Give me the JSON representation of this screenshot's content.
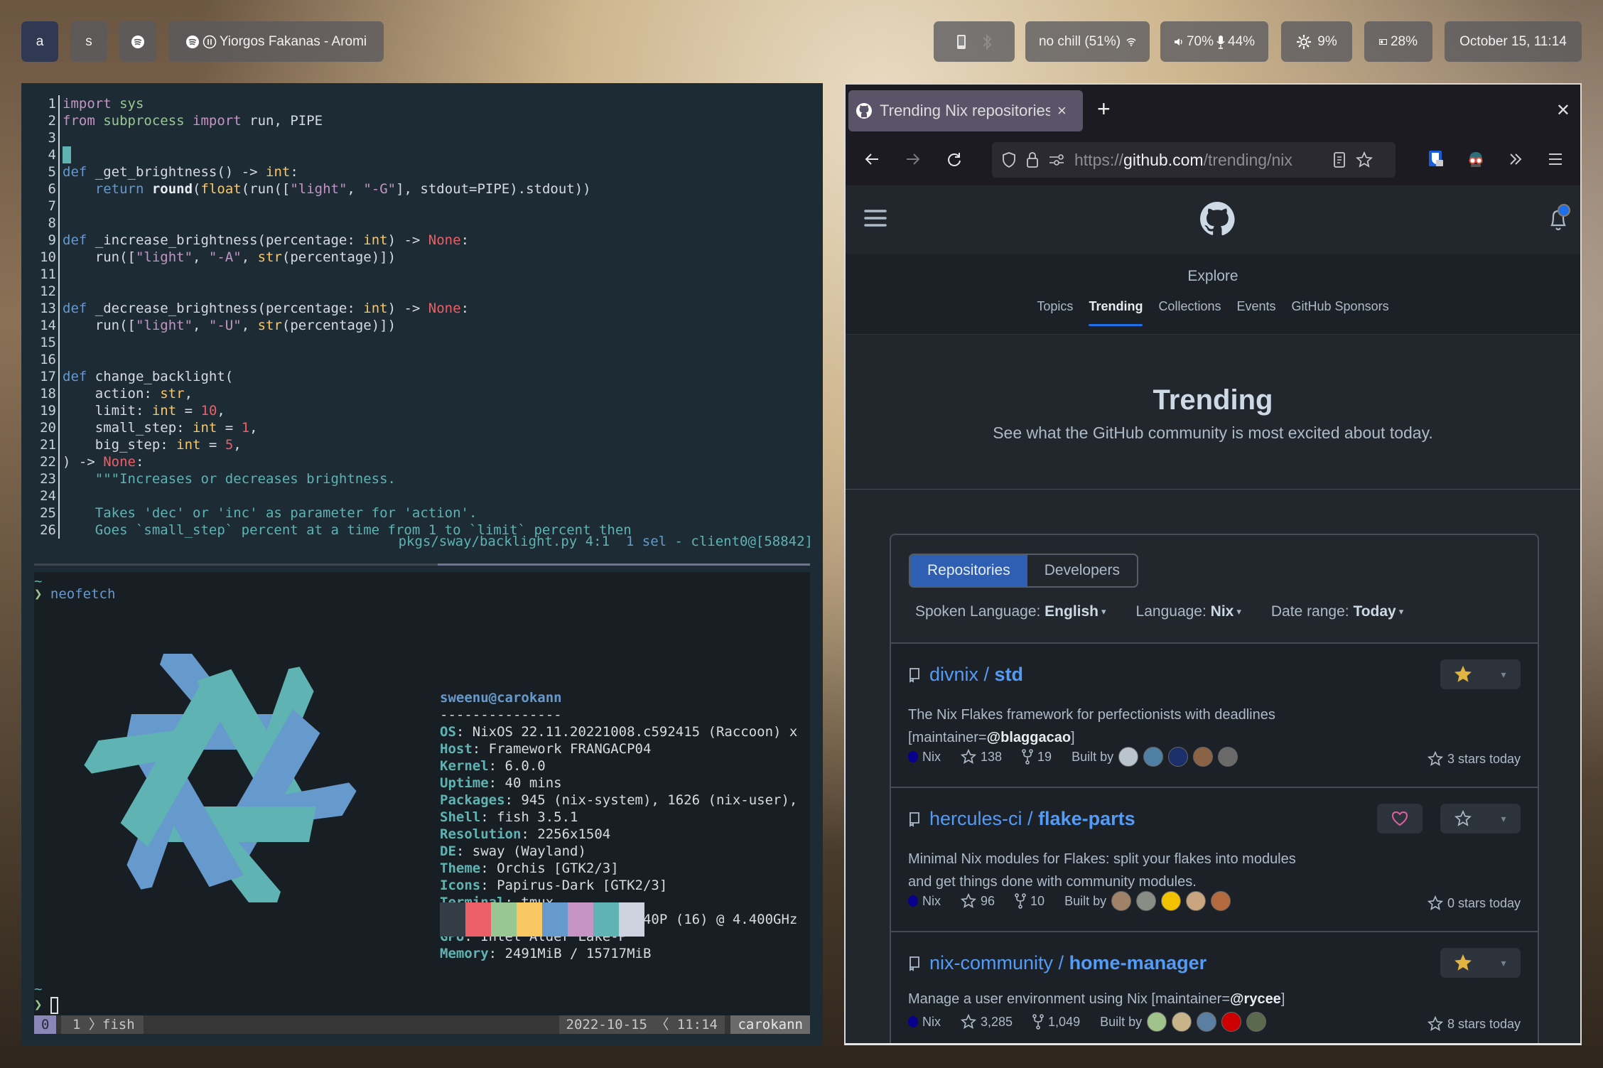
{
  "topbar": {
    "workspaces": [
      {
        "label": "a",
        "active": true
      },
      {
        "label": "s",
        "active": false
      }
    ],
    "spotify_icon": "spotify-icon",
    "media": {
      "track": "Yiorgos Fakanas - Aromi",
      "state_icon": "pause-icon"
    },
    "wifi": "no chill (51%)",
    "audio": {
      "volume": "70%",
      "mic": "44%"
    },
    "cpu": "9%",
    "battery": "28%",
    "clock": "October 15, 11:14"
  },
  "editor": {
    "lines": [
      {
        "n": "1"
      },
      {
        "n": "2"
      },
      {
        "n": "3"
      },
      {
        "n": "4"
      },
      {
        "n": "5"
      },
      {
        "n": "6"
      },
      {
        "n": "7"
      },
      {
        "n": "8"
      },
      {
        "n": "9"
      },
      {
        "n": "10"
      },
      {
        "n": "11"
      },
      {
        "n": "12"
      },
      {
        "n": "13"
      },
      {
        "n": "14"
      },
      {
        "n": "15"
      },
      {
        "n": "16"
      },
      {
        "n": "17"
      },
      {
        "n": "18"
      },
      {
        "n": "19"
      },
      {
        "n": "20"
      },
      {
        "n": "21"
      },
      {
        "n": "22"
      },
      {
        "n": "23"
      },
      {
        "n": "24"
      },
      {
        "n": "25"
      },
      {
        "n": "26"
      }
    ],
    "code": {
      "l1a": "import",
      "l1b": " sys",
      "l2a": "from",
      "l2b": " subprocess ",
      "l2c": "import",
      "l2d": " run, PIPE",
      "l5a": "def",
      "l5b": " _get_brightness() -> ",
      "l5c": "int",
      "l5d": ":",
      "l6a": "    return ",
      "l6b": "round",
      "l6c": "(",
      "l6d": "float",
      "l6e": "(run([",
      "l6f": "\"light\"",
      "l6g": ", ",
      "l6h": "\"-G\"",
      "l6i": "], stdout=PIPE).stdout))",
      "l9a": "def",
      "l9b": " _increase_brightness(percentage: ",
      "l9c": "int",
      "l9d": ") -> ",
      "l9e": "None",
      "l9f": ":",
      "l10a": "    run([",
      "l10b": "\"light\"",
      "l10c": ", ",
      "l10d": "\"-A\"",
      "l10e": ", ",
      "l10f": "str",
      "l10g": "(percentage)])",
      "l13a": "def",
      "l13b": " _decrease_brightness(percentage: ",
      "l13c": "int",
      "l13d": ") -> ",
      "l13e": "None",
      "l13f": ":",
      "l14a": "    run([",
      "l14b": "\"light\"",
      "l14c": ", ",
      "l14d": "\"-U\"",
      "l14e": ", ",
      "l14f": "str",
      "l14g": "(percentage)])",
      "l17a": "def",
      "l17b": " change_backlight(",
      "l18a": "    action: ",
      "l18b": "str",
      "l18c": ",",
      "l19a": "    limit: ",
      "l19b": "int",
      "l19c": " = ",
      "l19d": "10",
      "l19e": ",",
      "l20a": "    small_step: ",
      "l20b": "int",
      "l20c": " = ",
      "l20d": "1",
      "l20e": ",",
      "l21a": "    big_step: ",
      "l21b": "int",
      "l21c": " = ",
      "l21d": "5",
      "l21e": ",",
      "l22a": ") -> ",
      "l22b": "None",
      "l22c": ":",
      "l23": "    \"\"\"Increases or decreases brightness.",
      "l25": "    Takes 'dec' or 'inc' as parameter for 'action'.",
      "l26": "    Goes `small_step` percent at a time from 1 to `limit` percent then"
    },
    "status": {
      "file": "pkgs/sway/backlight.py 4:1 ",
      "sel": " 1 sel",
      "client": " - client0@[58842]"
    }
  },
  "terminal": {
    "cwd": "~",
    "prompt_arrow": "❯",
    "command": "neofetch",
    "neofetch": {
      "userhost": "sweenu@carokann",
      "rule": "---------------",
      "fields": [
        {
          "key": "OS",
          "value": "NixOS 22.11.20221008.c592415 (Raccoon) x"
        },
        {
          "key": "Host",
          "value": "Framework FRANGACP04"
        },
        {
          "key": "Kernel",
          "value": "6.0.0"
        },
        {
          "key": "Uptime",
          "value": "40 mins"
        },
        {
          "key": "Packages",
          "value": "945 (nix-system), 1626 (nix-user),"
        },
        {
          "key": "Shell",
          "value": "fish 3.5.1"
        },
        {
          "key": "Resolution",
          "value": "2256x1504"
        },
        {
          "key": "DE",
          "value": "sway (Wayland)"
        },
        {
          "key": "Theme",
          "value": "Orchis [GTK2/3]"
        },
        {
          "key": "Icons",
          "value": "Papirus-Dark [GTK2/3]"
        },
        {
          "key": "Terminal",
          "value": "tmux"
        },
        {
          "key": "CPU",
          "value": "12th Gen Intel i5-1240P (16) @ 4.400GHz"
        },
        {
          "key": "GPU",
          "value": "Intel Alder Lake-P"
        },
        {
          "key": "Memory",
          "value": "2491MiB / 15717MiB"
        }
      ],
      "palette": [
        "#343d46",
        "#ec5f67",
        "#99c794",
        "#fac863",
        "#6699cc",
        "#c594c5",
        "#5fb3b3",
        "#cdd3de"
      ],
      "logo_colors": {
        "blue": "#6699cc",
        "teal": "#5fb3b3"
      }
    },
    "tmux": {
      "session": "0",
      "window_index": "1",
      "window_name": "fish",
      "date": "2022-10-15",
      "time": "11:14",
      "host": "carokann"
    }
  },
  "browser": {
    "tab": {
      "title": "Trending Nix repositories",
      "close": "×"
    },
    "new_tab": "+",
    "window_close": "✕",
    "url": {
      "scheme": "https://",
      "host": "github.com",
      "path": "/trending/nix"
    },
    "github": {
      "explore": "Explore",
      "subnav": [
        "Topics",
        "Trending",
        "Collections",
        "Events",
        "GitHub Sponsors"
      ],
      "active_subnav": "Trending",
      "hero_title": "Trending",
      "hero_sub": "See what the GitHub community is most excited about today.",
      "toggle": {
        "repos": "Repositories",
        "devs": "Developers"
      },
      "filters": [
        {
          "label": "Spoken Language: ",
          "value": "English"
        },
        {
          "label": "Language: ",
          "value": "Nix"
        },
        {
          "label": "Date range: ",
          "value": "Today"
        }
      ],
      "repos": [
        {
          "owner": "divnix",
          "name": "std",
          "desc1": "The Nix Flakes framework for perfectionists with deadlines",
          "desc2": "[maintainer=",
          "desc_user": "@blaggacao",
          "desc3": "]",
          "lang": "Nix",
          "stars": "138",
          "forks": "19",
          "built_by": "Built by",
          "today": "3 stars today",
          "starred": true,
          "sponsor": false
        },
        {
          "owner": "hercules-ci",
          "name": "flake-parts",
          "desc1": "Minimal Nix modules for Flakes: split your flakes into modules",
          "desc2": "and get things done with community modules.",
          "desc_user": "",
          "desc3": "",
          "lang": "Nix",
          "stars": "96",
          "forks": "10",
          "built_by": "Built by",
          "today": "0 stars today",
          "starred": false,
          "sponsor": true
        },
        {
          "owner": "nix-community",
          "name": "home-manager",
          "desc1": "Manage a user environment using Nix [maintainer=",
          "desc2": "",
          "desc_user": "@rycee",
          "desc3": "]",
          "lang": "Nix",
          "stars": "3,285",
          "forks": "1,049",
          "built_by": "Built by",
          "today": "8 stars today",
          "starred": true,
          "sponsor": false
        }
      ]
    }
  }
}
